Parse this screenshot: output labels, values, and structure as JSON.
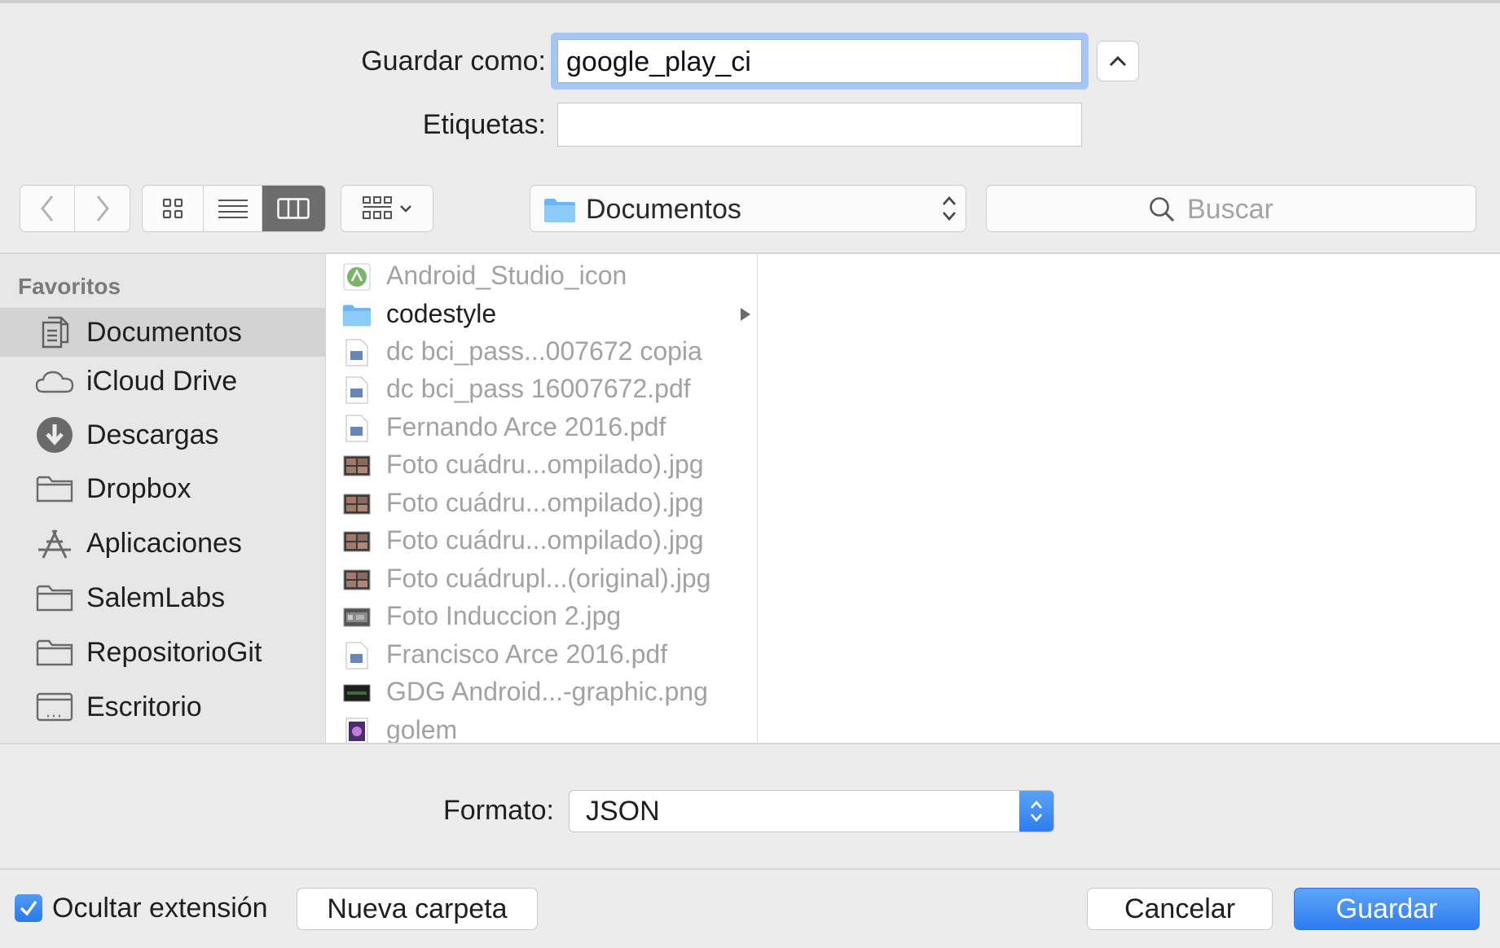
{
  "name_field": {
    "label": "Guardar como:",
    "value": "google_play_ci"
  },
  "tags_field": {
    "label": "Etiquetas:",
    "value": ""
  },
  "toolbar": {
    "location": "Documentos",
    "search_placeholder": "Buscar",
    "active_view": "column"
  },
  "sidebar": {
    "heading": "Favoritos",
    "items": [
      {
        "label": "Documentos",
        "icon": "documents-icon",
        "selected": true
      },
      {
        "label": "iCloud Drive",
        "icon": "cloud-icon"
      },
      {
        "label": "Descargas",
        "icon": "download-icon"
      },
      {
        "label": "Dropbox",
        "icon": "folder-icon"
      },
      {
        "label": "Aplicaciones",
        "icon": "applications-icon"
      },
      {
        "label": "SalemLabs",
        "icon": "folder-icon"
      },
      {
        "label": "RepositorioGit",
        "icon": "folder-icon"
      },
      {
        "label": "Escritorio",
        "icon": "desktop-icon"
      }
    ]
  },
  "files": [
    {
      "name": "Android_Studio_icon",
      "icon": "android-studio-icon",
      "enabled": false
    },
    {
      "name": "codestyle",
      "icon": "folder-icon",
      "enabled": true,
      "has_children": true
    },
    {
      "name": "dc bci_pass...007672 copia",
      "icon": "pdf-icon",
      "enabled": false
    },
    {
      "name": "dc bci_pass 16007672.pdf",
      "icon": "pdf-icon",
      "enabled": false
    },
    {
      "name": "Fernando Arce 2016.pdf",
      "icon": "pdf-icon",
      "enabled": false
    },
    {
      "name": "Foto cuádru...ompilado).jpg",
      "icon": "image-icon",
      "enabled": false
    },
    {
      "name": "Foto cuádru...ompilado).jpg",
      "icon": "image-icon",
      "enabled": false
    },
    {
      "name": "Foto cuádru...ompilado).jpg",
      "icon": "image-icon",
      "enabled": false
    },
    {
      "name": "Foto cuádrupl...(original).jpg",
      "icon": "image-icon",
      "enabled": false
    },
    {
      "name": "Foto Induccion 2.jpg",
      "icon": "image-icon",
      "enabled": false
    },
    {
      "name": "Francisco Arce 2016.pdf",
      "icon": "pdf-icon",
      "enabled": false
    },
    {
      "name": "GDG Android...-graphic.png",
      "icon": "image-dark-icon",
      "enabled": false
    },
    {
      "name": "golem",
      "icon": "app-icon",
      "enabled": false
    }
  ],
  "format": {
    "label": "Formato:",
    "value": "JSON"
  },
  "footer": {
    "hide_extension_label": "Ocultar extensión",
    "hide_extension_checked": true,
    "new_folder": "Nueva carpeta",
    "cancel": "Cancelar",
    "save": "Guardar"
  },
  "colors": {
    "accent": "#2f7cf0",
    "focus_ring": "#a6c6f3"
  }
}
